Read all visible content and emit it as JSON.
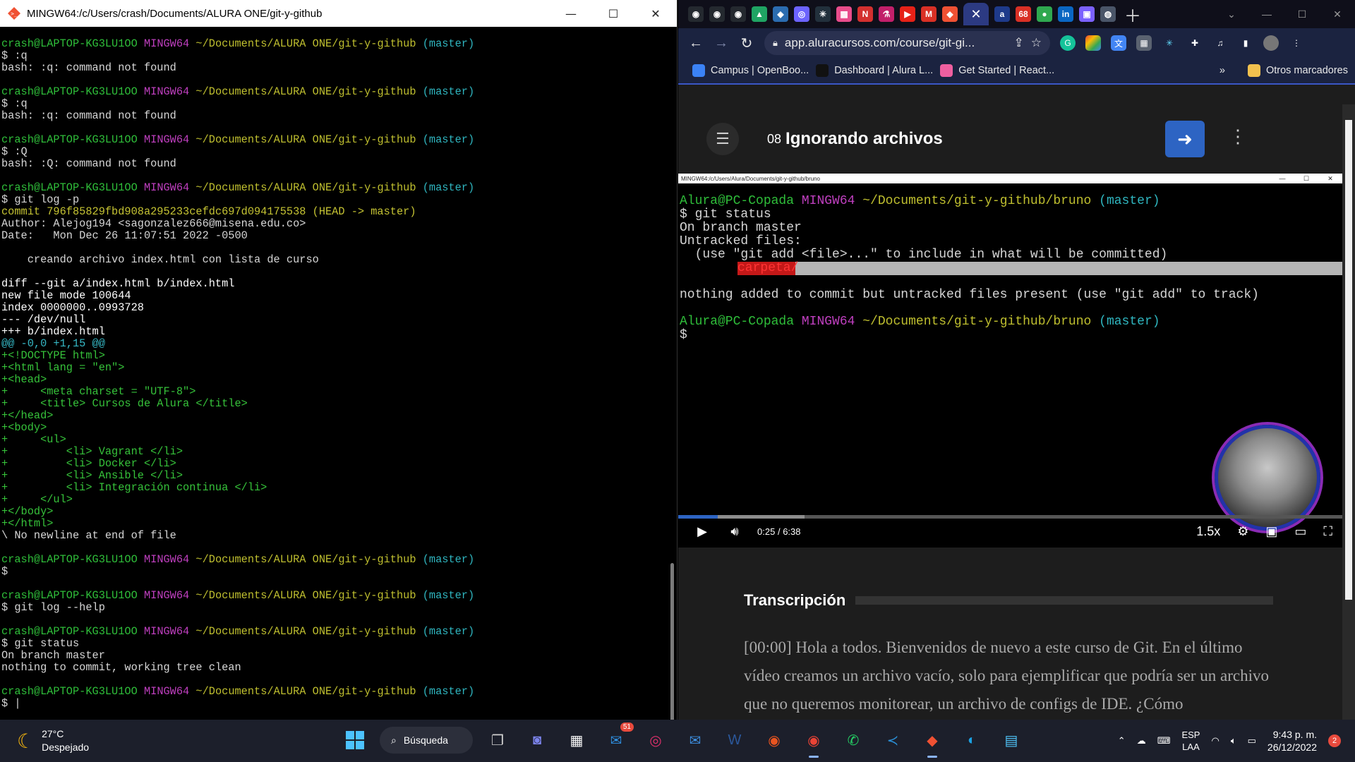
{
  "terminal": {
    "title": "MINGW64:/c/Users/crash/Documents/ALURA ONE/git-y-github",
    "prompt": {
      "user": "crash@LAPTOP-KG3LU1OO",
      "env": "MINGW64",
      "path": "~/Documents/ALURA ONE/git-y-github",
      "branch": "(master)"
    },
    "lines": [
      {
        "type": "prompt"
      },
      {
        "type": "text",
        "text": "$ :q"
      },
      {
        "type": "text",
        "text": "bash: :q: command not found"
      },
      {
        "type": "blank"
      },
      {
        "type": "prompt"
      },
      {
        "type": "text",
        "text": "$ :q"
      },
      {
        "type": "text",
        "text": "bash: :q: command not found"
      },
      {
        "type": "blank"
      },
      {
        "type": "prompt"
      },
      {
        "type": "text",
        "text": "$ :Q"
      },
      {
        "type": "text",
        "text": "bash: :Q: command not found"
      },
      {
        "type": "blank"
      },
      {
        "type": "prompt"
      },
      {
        "type": "text",
        "text": "$ git log -p"
      },
      {
        "type": "commit",
        "hash": "commit 796f85829fbd908a295233cefdc697d094175538",
        "ref": "(HEAD -> master)"
      },
      {
        "type": "text",
        "text": "Author: Alejog194 <sagonzalez666@misena.edu.co>"
      },
      {
        "type": "text",
        "text": "Date:   Mon Dec 26 11:07:51 2022 -0500"
      },
      {
        "type": "blank"
      },
      {
        "type": "text",
        "text": "    creando archivo index.html con lista de curso"
      },
      {
        "type": "blank"
      },
      {
        "type": "bold",
        "text": "diff --git a/index.html b/index.html"
      },
      {
        "type": "bold",
        "text": "new file mode 100644"
      },
      {
        "type": "bold",
        "text": "index 0000000..0993728"
      },
      {
        "type": "bold",
        "text": "--- /dev/null"
      },
      {
        "type": "bold",
        "text": "+++ b/index.html"
      },
      {
        "type": "hunk",
        "text": "@@ -0,0 +1,15 @@"
      },
      {
        "type": "add",
        "text": "+<!DOCTYPE html>"
      },
      {
        "type": "add",
        "text": "+<html lang = \"en\">"
      },
      {
        "type": "add",
        "text": "+<head>"
      },
      {
        "type": "add",
        "text": "+     <meta charset = \"UTF-8\">"
      },
      {
        "type": "add",
        "text": "+     <title> Cursos de Alura </title>"
      },
      {
        "type": "add",
        "text": "+</head>"
      },
      {
        "type": "add",
        "text": "+<body>"
      },
      {
        "type": "add",
        "text": "+     <ul>"
      },
      {
        "type": "add",
        "text": "+         <li> Vagrant </li>"
      },
      {
        "type": "add",
        "text": "+         <li> Docker </li>"
      },
      {
        "type": "add",
        "text": "+         <li> Ansible </li>"
      },
      {
        "type": "add",
        "text": "+         <li> Integración continua </li>"
      },
      {
        "type": "add",
        "text": "+     </ul>"
      },
      {
        "type": "add",
        "text": "+</body>"
      },
      {
        "type": "add",
        "text": "+</html>"
      },
      {
        "type": "text",
        "text": "\\ No newline at end of file"
      },
      {
        "type": "blank"
      },
      {
        "type": "prompt"
      },
      {
        "type": "text",
        "text": "$"
      },
      {
        "type": "blank"
      },
      {
        "type": "prompt"
      },
      {
        "type": "text",
        "text": "$ git log --help"
      },
      {
        "type": "blank"
      },
      {
        "type": "prompt"
      },
      {
        "type": "text",
        "text": "$ git status"
      },
      {
        "type": "text",
        "text": "On branch master"
      },
      {
        "type": "text",
        "text": "nothing to commit, working tree clean"
      },
      {
        "type": "blank"
      },
      {
        "type": "prompt"
      },
      {
        "type": "text",
        "text": "$ |"
      }
    ]
  },
  "browser": {
    "url": "app.aluracursos.com/course/git-gi...",
    "bookmarks": [
      {
        "label": "Campus | OpenBoo...",
        "color": "#3b82f6"
      },
      {
        "label": "Dashboard | Alura L...",
        "color": "#111111"
      },
      {
        "label": "Get Started | React...",
        "color": "#ef5fa0"
      }
    ],
    "more_chevron": "»",
    "other_bookmarks": "Otros marcadores",
    "tab_favicons": [
      {
        "icon": "github-icon",
        "color": "#24292f",
        "glyph": "◉"
      },
      {
        "icon": "github-icon",
        "color": "#24292f",
        "glyph": "◉"
      },
      {
        "icon": "github-icon",
        "color": "#24292f",
        "glyph": "◉"
      },
      {
        "icon": "drive-icon",
        "color": "#1fa463",
        "glyph": "▲"
      },
      {
        "icon": "badge-icon",
        "color": "#2b6cb0",
        "glyph": "◆"
      },
      {
        "icon": "badge-icon",
        "color": "#6c63ff",
        "glyph": "◎"
      },
      {
        "icon": "react-icon",
        "color": "#22303c",
        "glyph": "✳"
      },
      {
        "icon": "app-icon",
        "color": "#e84c8b",
        "glyph": "▦"
      },
      {
        "icon": "notion-icon",
        "color": "#d3302f",
        "glyph": "N"
      },
      {
        "icon": "app-icon",
        "color": "#c21f6a",
        "glyph": "⚗"
      },
      {
        "icon": "youtube-icon",
        "color": "#e62117",
        "glyph": "▶"
      },
      {
        "icon": "gmail-icon",
        "color": "#d93025",
        "glyph": "M"
      },
      {
        "icon": "git-icon",
        "color": "#f05133",
        "glyph": "◆"
      }
    ],
    "tab_favicons_after": [
      {
        "icon": "alura-icon",
        "color": "#1e3a8a",
        "glyph": "a"
      },
      {
        "icon": "app-icon",
        "color": "#d93025",
        "glyph": "68"
      },
      {
        "icon": "app-icon",
        "color": "#2fa84f",
        "glyph": "●"
      },
      {
        "icon": "linkedin-icon",
        "color": "#0a66c2",
        "glyph": "in"
      },
      {
        "icon": "app-icon",
        "color": "#7b61ff",
        "glyph": "▣"
      },
      {
        "icon": "globe-icon",
        "color": "#4a5568",
        "glyph": "◍"
      }
    ],
    "lesson": {
      "number": "08",
      "title": "Ignorando archivos"
    },
    "video": {
      "term_title": "MINGW64:/c/Users/Alura/Documents/git-y-github/bruno",
      "prompt": {
        "user": "Alura@PC-Copada",
        "env": "MINGW64",
        "path": "~/Documents/git-y-github/bruno",
        "branch": "(master)"
      },
      "lines": [
        {
          "type": "prompt"
        },
        {
          "type": "text",
          "text": "$ git status"
        },
        {
          "type": "text",
          "text": "On branch master"
        },
        {
          "type": "text",
          "text": "Untracked files:"
        },
        {
          "type": "text",
          "text": "  (use \"git add <file>...\" to include in what will be committed)"
        },
        {
          "type": "untracked",
          "text": "carpeta/"
        },
        {
          "type": "blank"
        },
        {
          "type": "text",
          "text": "nothing added to commit but untracked files present (use \"git add\" to track)"
        },
        {
          "type": "blank"
        },
        {
          "type": "prompt"
        },
        {
          "type": "text",
          "text": "$"
        }
      ],
      "current_time": "0:25",
      "separator": "/",
      "duration": "6:38",
      "progress": 0.06,
      "speed": "1.5x"
    },
    "transcript": {
      "heading": "Transcripción",
      "text": "[00:00] Hola a todos. Bienvenidos de nuevo a este curso de Git. En el último vídeo creamos un archivo vacío, solo para ejemplificar que podría ser un archivo que no queremos monitorear, un archivo de configs de IDE. ¿Cómo"
    }
  },
  "taskbar": {
    "weather": {
      "temp": "27°C",
      "desc": "Despejado"
    },
    "search_label": "Búsqueda",
    "apps": [
      {
        "name": "task-view-icon",
        "glyph": "❐",
        "color": "#d0d0d0"
      },
      {
        "name": "teams-icon",
        "glyph": "◙",
        "color": "#7b83eb"
      },
      {
        "name": "store-icon",
        "glyph": "▦",
        "color": "#f5f5f5"
      },
      {
        "name": "outlook-icon",
        "glyph": "✉",
        "color": "#2f8fe0",
        "badge": "51"
      },
      {
        "name": "instagram-icon",
        "glyph": "◎",
        "color": "#e1306c"
      },
      {
        "name": "mail-icon",
        "glyph": "✉",
        "color": "#3d8ee0"
      },
      {
        "name": "word-icon",
        "glyph": "W",
        "color": "#2b579a"
      },
      {
        "name": "ubuntu-icon",
        "glyph": "◉",
        "color": "#e95420"
      },
      {
        "name": "chrome-icon",
        "glyph": "◉",
        "color": "#ea4335",
        "active": true
      },
      {
        "name": "whatsapp-icon",
        "glyph": "✆",
        "color": "#25d366"
      },
      {
        "name": "vscode-icon",
        "glyph": "≺",
        "color": "#2b8fd6"
      },
      {
        "name": "git-bash-icon",
        "glyph": "◆",
        "color": "#f05133",
        "active": true
      },
      {
        "name": "edge-icon",
        "glyph": "◐",
        "color": "#1ba1e2"
      },
      {
        "name": "notepad-icon",
        "glyph": "▤",
        "color": "#4fc3f7"
      }
    ],
    "lang": "ESP",
    "layout": "LAA",
    "time": "9:43 p. m.",
    "date": "26/12/2022",
    "notifications": "2"
  }
}
